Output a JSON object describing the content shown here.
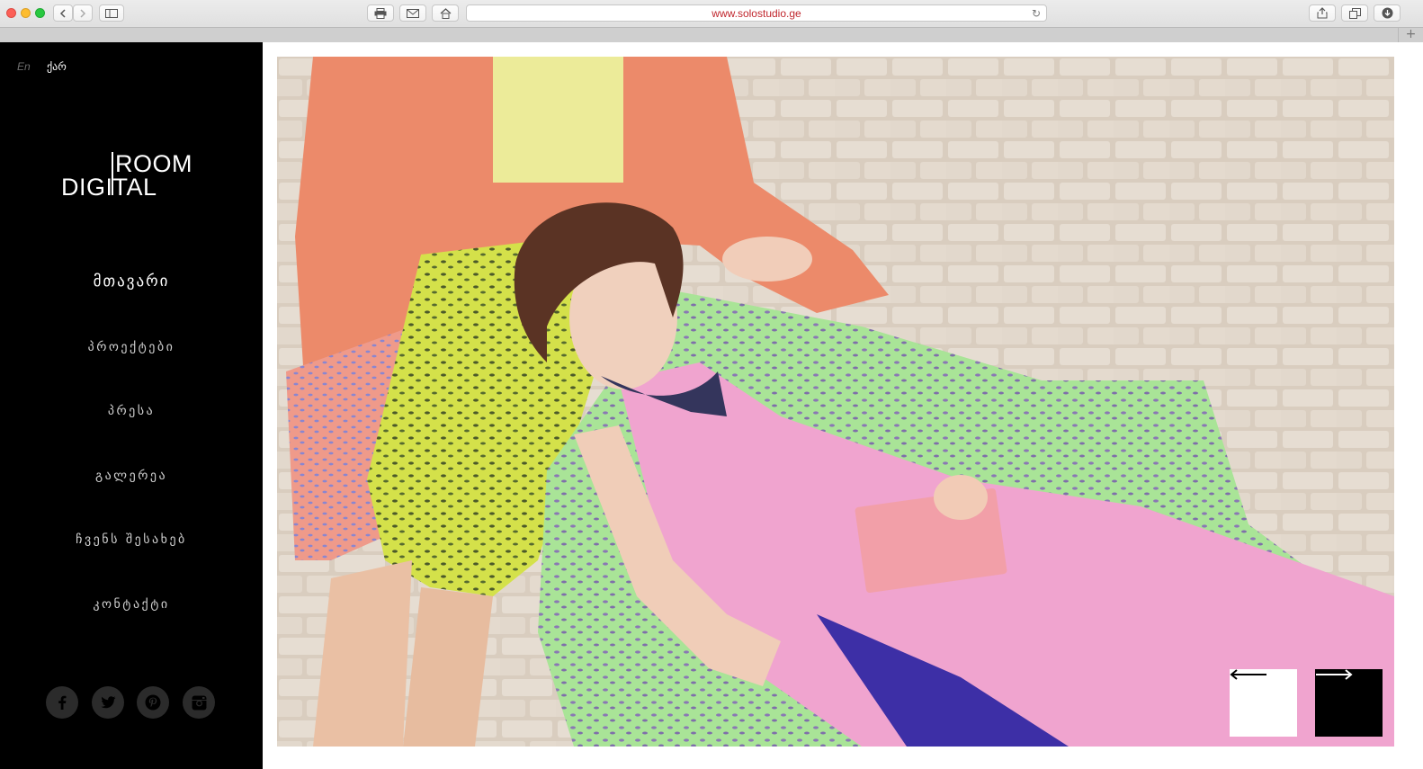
{
  "browser": {
    "url": "www.solostudio.ge",
    "new_tab_glyph": "+"
  },
  "sidebar": {
    "lang_en": "En",
    "lang_ka": "ქარ",
    "logo": {
      "line1": "ROOM",
      "line2": "DIGITAL"
    },
    "nav": [
      {
        "label": "მთავარი",
        "active": true
      },
      {
        "label": "პროექტები",
        "active": false
      },
      {
        "label": "პრესა",
        "active": false
      },
      {
        "label": "გალერეა",
        "active": false
      },
      {
        "label": "ჩვენს შესახებ",
        "active": false
      },
      {
        "label": "კონტაქტი",
        "active": false
      }
    ],
    "social_icons": [
      "facebook-icon",
      "twitter-icon",
      "pinterest-icon",
      "instagram-icon"
    ]
  },
  "slider": {
    "prev_icon": "arrow-left-icon",
    "next_icon": "arrow-right-icon"
  },
  "colors": {
    "sidebar_bg": "#000000",
    "url_text": "#c0262d",
    "social_circle": "#2b2b2b"
  }
}
